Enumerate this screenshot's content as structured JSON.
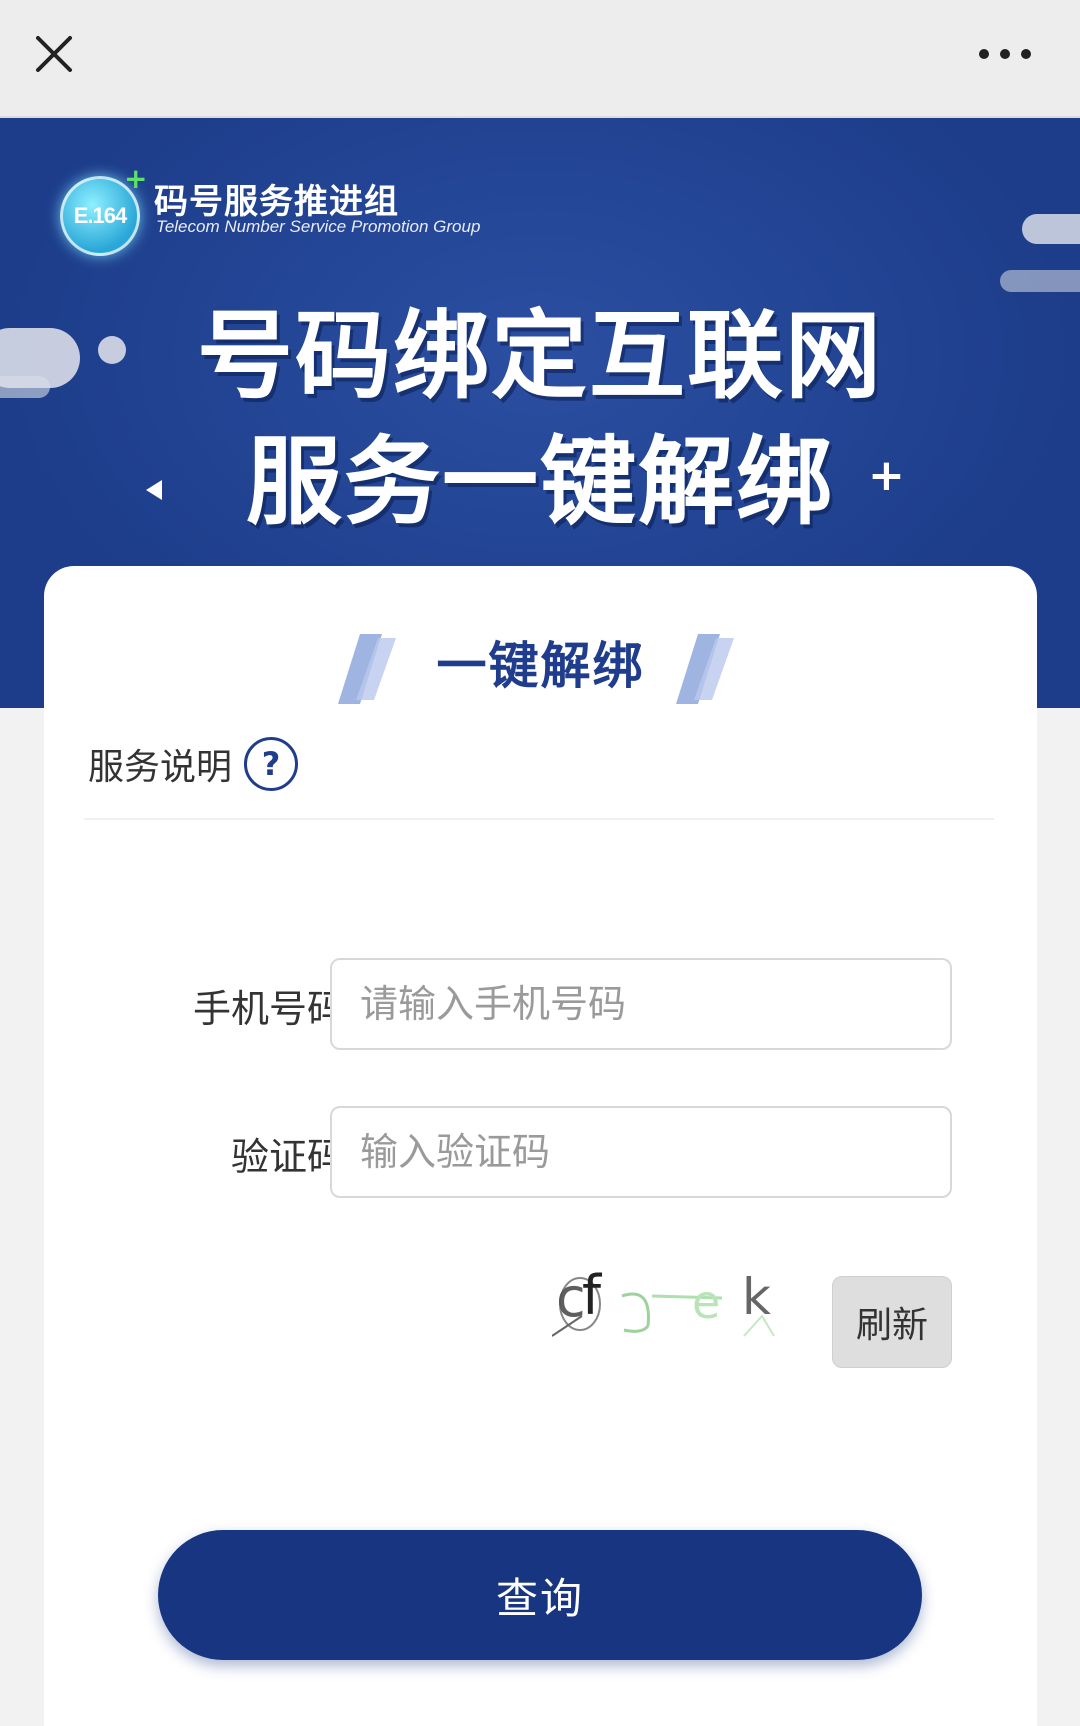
{
  "topbar": {
    "close_icon": "close-icon",
    "more_icon": "more-horizontal-icon"
  },
  "banner": {
    "logo_text": "E.164",
    "org_name": "码号服务推进组",
    "org_name_en": "Telecom Number Service  Promotion Group",
    "headline_line1": "号码绑定互联网",
    "headline_line2": "服务一键解绑",
    "plus_mark": "+",
    "colors": {
      "background": "#1d3d8a",
      "text": "#ffffff"
    }
  },
  "card": {
    "title": "一键解绑",
    "service_label": "服务说明",
    "help_icon_glyph": "?",
    "phone": {
      "label": "手机号码",
      "placeholder": "请输入手机号码",
      "value": ""
    },
    "code": {
      "label": "验证码",
      "placeholder": "输入验证码",
      "value": ""
    },
    "captcha": {
      "text": "cf e k"
    },
    "refresh_label": "刷新",
    "submit_label": "查询",
    "colors": {
      "primary": "#173580",
      "title": "#1f3d8c"
    }
  }
}
